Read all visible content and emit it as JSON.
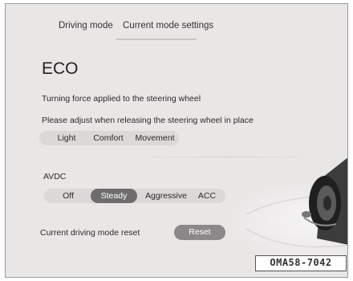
{
  "tabs": [
    {
      "label": "Driving mode"
    },
    {
      "label": "Current mode settings"
    }
  ],
  "mode_title": "ECO",
  "steering": {
    "description_1": "Turning force applied to the steering wheel",
    "description_2": "Please adjust when releasing the steering wheel in place",
    "options": [
      "Light",
      "Comfort",
      "Movement"
    ],
    "selected": "none"
  },
  "avdc": {
    "label": "AVDC",
    "options": [
      "Off",
      "Steady",
      "Aggressive",
      "ACC"
    ],
    "selected": "Steady"
  },
  "reset": {
    "label": "Current driving mode reset",
    "button_label": "Reset"
  },
  "figure_code": "OMA58-7042",
  "illustration": "car-wheel-icon",
  "colors": {
    "background": "#e9e6e6",
    "segment_bg": "#dcd8d8",
    "active_segment": "#6e6c6c",
    "reset_button": "#8a8888"
  }
}
